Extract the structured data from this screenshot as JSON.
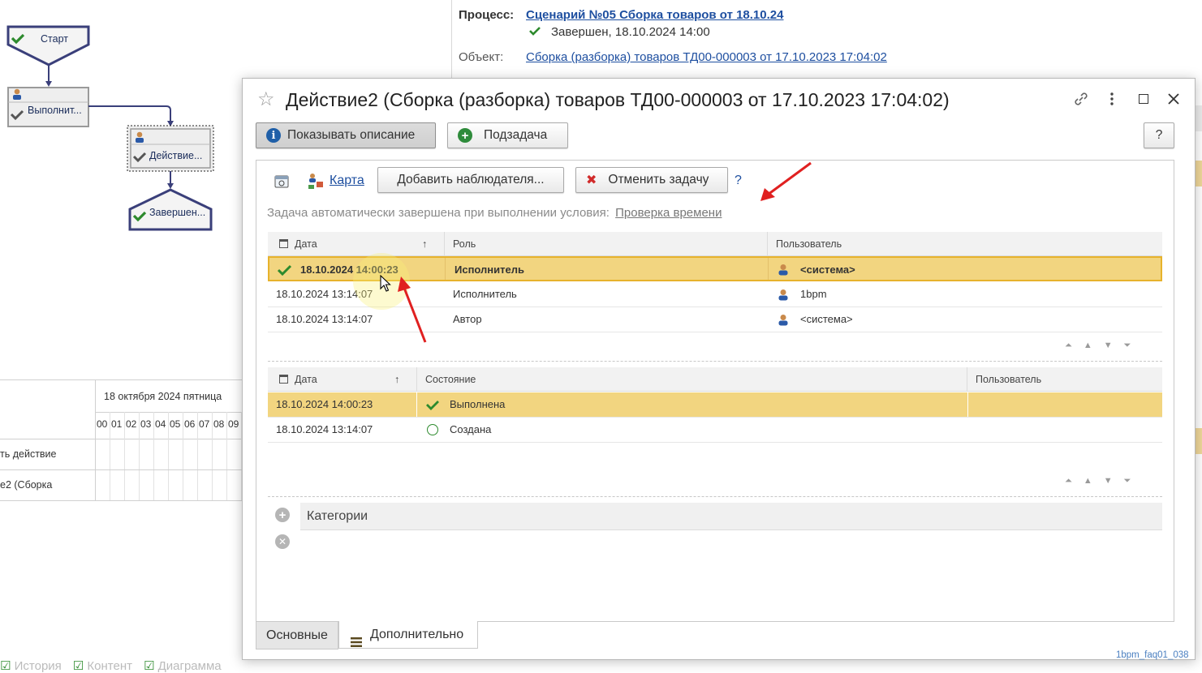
{
  "flow": {
    "start": "Старт",
    "node1": "Выполнит...",
    "node2": "Действие...",
    "end": "Завершен..."
  },
  "process": {
    "label": "Процесс:",
    "link": "Сценарий №05 Сборка товаров от 18.10.24",
    "status": "Завершен, 18.10.2024 14:00",
    "object_label": "Объект:",
    "object_link": "Сборка (разборка) товаров ТД00-000003 от 17.10.2023 17:04:02"
  },
  "gantt": {
    "date": "18 октября 2024 пятница",
    "hours": [
      "00",
      "01",
      "02",
      "03",
      "04",
      "05",
      "06",
      "07",
      "08",
      "09"
    ],
    "row1": "ть действие",
    "row2": "е2 (Сборка"
  },
  "bottom_checks": [
    "История",
    "Контент",
    "Диаграмма"
  ],
  "dialog": {
    "title": "Действие2 (Сборка (разборка) товаров ТД00-000003 от 17.10.2023 17:04:02)",
    "show_desc": "Показывать описание",
    "subtask": "Подзадача",
    "help": "?",
    "map": "Карта",
    "add_observer": "Добавить наблюдателя...",
    "cancel_task": "Отменить задачу",
    "qmark": "?",
    "auto_text": "Задача автоматически завершена при выполнении условия:",
    "auto_link": "Проверка времени",
    "table1": {
      "headers": [
        "Дата",
        "Роль",
        "Пользователь"
      ],
      "rows": [
        {
          "date": "18.10.2024 14:00:23",
          "role": "Исполнитель",
          "user": "<система>"
        },
        {
          "date": "18.10.2024 13:14:07",
          "role": "Исполнитель",
          "user": "1bpm"
        },
        {
          "date": "18.10.2024 13:14:07",
          "role": "Автор",
          "user": "<система>"
        }
      ]
    },
    "table2": {
      "headers": [
        "Дата",
        "Состояние",
        "Пользователь"
      ],
      "rows": [
        {
          "date": "18.10.2024 14:00:23",
          "state": "Выполнена",
          "user": ""
        },
        {
          "date": "18.10.2024 13:14:07",
          "state": "Создана",
          "user": ""
        }
      ]
    },
    "categories": "Категории",
    "tabs": [
      "Основные",
      "Дополнительно"
    ],
    "watermark": "1bpm_faq01_038"
  }
}
